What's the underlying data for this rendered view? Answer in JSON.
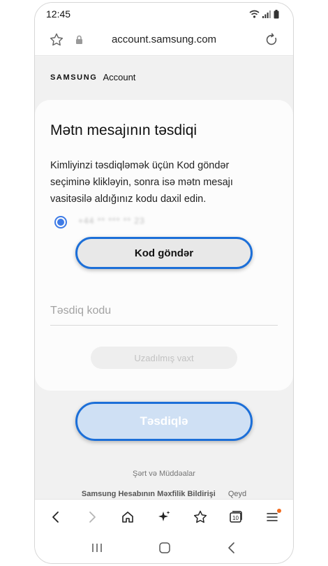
{
  "status_bar": {
    "time": "12:45"
  },
  "url_bar": {
    "url": "account.samsung.com"
  },
  "brand": {
    "samsung": "SAMSUNG",
    "account": "Account"
  },
  "card": {
    "title": "Mətn mesajının təsdiqi",
    "description": "Kimliyinzi təsdiqləmək üçün Kod göndər seçiminə klikləyin, sonra isə mətn mesajı vasitəsilə aldığınız kodu daxil edin.",
    "masked_phone": "+44 ** *** ** 23",
    "send_code_label": "Kod göndər",
    "code_placeholder": "Təsdiq kodu",
    "extend_label": "Uzadılmış vaxt"
  },
  "confirm_label": "Təsdiqlə",
  "footer": {
    "terms": "Şərt və Müddəalar",
    "privacy": "Samsung Hesabının Məxfilik Bildirişi",
    "note": "Qeyd"
  },
  "toolbar": {
    "tabs_count": "10",
    "icons": [
      "back-icon",
      "forward-icon",
      "home-icon",
      "ai-sparkle-icon",
      "bookmark-star-icon",
      "tabs-icon",
      "menu-icon"
    ]
  },
  "colors": {
    "accent": "#1c6fd8",
    "radio": "#3e7be6",
    "confirm_bg": "#cfe0f4",
    "notif": "#f26b1d"
  }
}
